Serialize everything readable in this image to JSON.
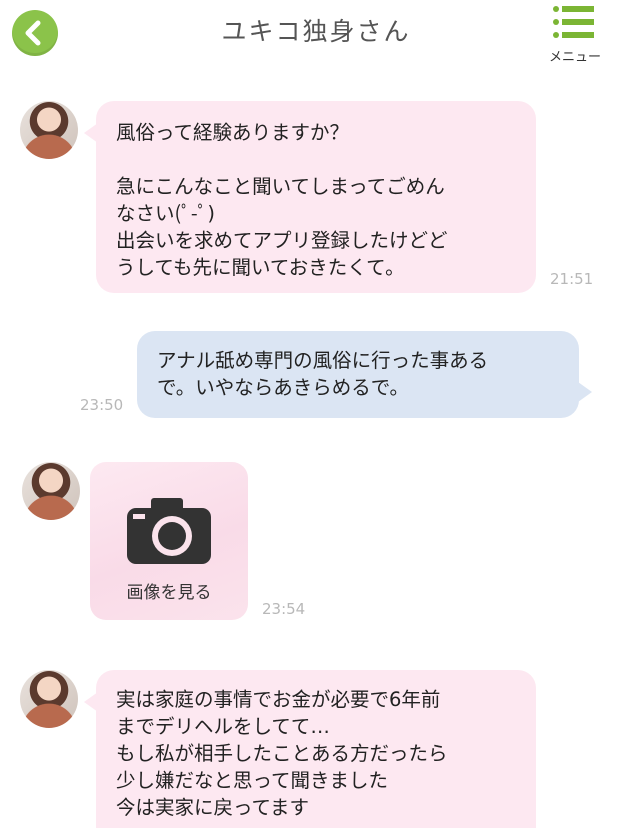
{
  "header": {
    "title": "ユキコ独身さん",
    "menu_label": "メニュー",
    "accent_color": "#8bc34a",
    "menu_icon_color": "#7bb534"
  },
  "messages": [
    {
      "sender": "other",
      "lines": [
        "風俗って経験ありますか？",
        "",
        "急にこんなこと聞いてしまってごめん",
        "なさい(ﾟ-ﾟ)",
        "出会いを求めてアプリ登録したけどど",
        "うしても先に聞いておきたくて。"
      ],
      "time": "21:51"
    },
    {
      "sender": "me",
      "lines": [
        "アナル舐め専門の風俗に行った事ある",
        "で。いやならあきらめるで。"
      ],
      "time": "23:50"
    },
    {
      "sender": "other",
      "type": "image",
      "caption": "画像を見る",
      "icon": "camera-icon",
      "time": "23:54"
    },
    {
      "sender": "other",
      "lines": [
        "実は家庭の事情でお金が必要で6年前",
        "までデリヘルをしてて…",
        "もし私が相手したことある方だったら",
        "少し嫌だなと思って聞きました",
        "今は実家に戻ってます"
      ]
    }
  ]
}
